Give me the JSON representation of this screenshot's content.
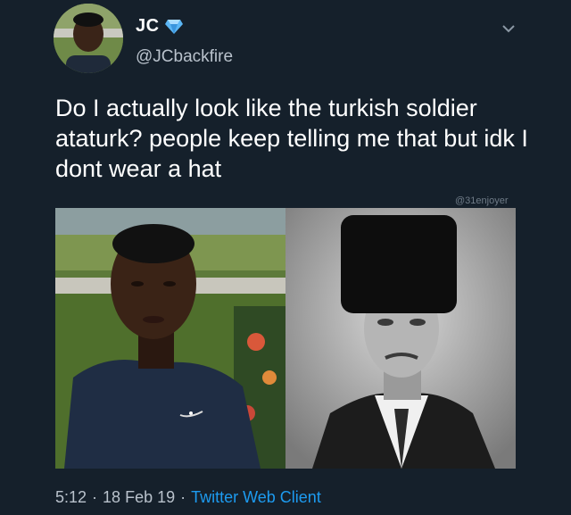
{
  "user": {
    "display_name": "JC",
    "handle": "@JCbackfire",
    "verified_badge_icon": "diamond-icon",
    "verified_badge_color": "#5bb6f5"
  },
  "tweet": {
    "text": "Do I actually look like the turkish soldier ataturk? people keep telling me that but idk I dont wear a hat",
    "watermark": "@31enjoyer"
  },
  "meta": {
    "time": "5:12",
    "separator1": "·",
    "date": "18 Feb 19",
    "separator2": "·",
    "client": "Twitter Web Client"
  },
  "colors": {
    "background": "#15202b",
    "link": "#1d9bf0"
  },
  "icons": {
    "menu": "chevron-down-icon"
  }
}
